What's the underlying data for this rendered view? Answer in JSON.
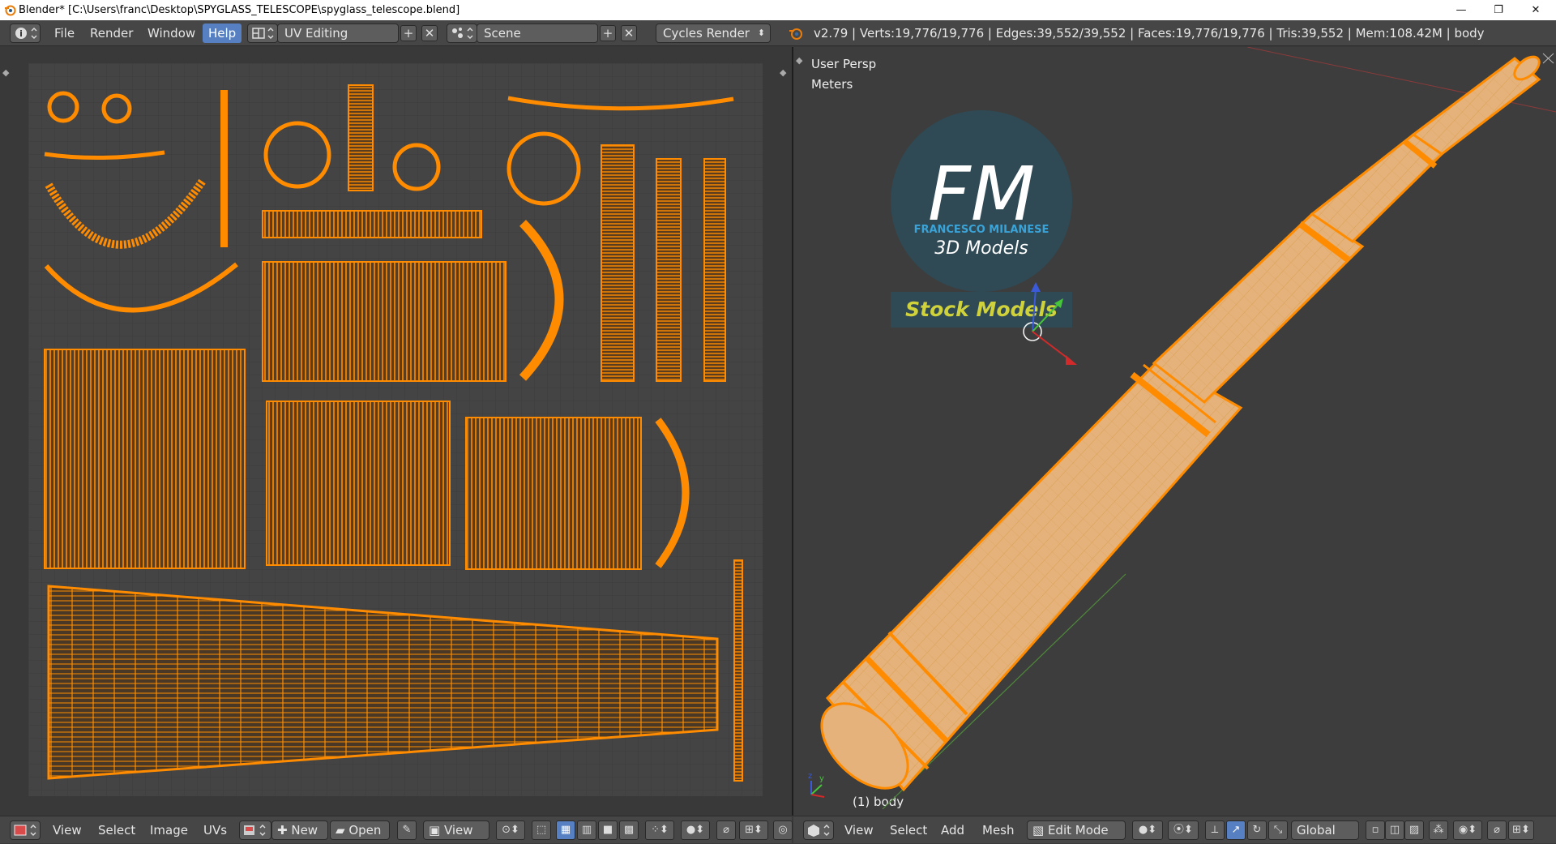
{
  "window": {
    "title": "Blender* [C:\\Users\\franc\\Desktop\\SPYGLASS_TELESCOPE\\spyglass_telescope.blend]",
    "minimize": "—",
    "maximize": "❐",
    "close": "✕"
  },
  "info_header": {
    "menus": [
      "File",
      "Render",
      "Window",
      "Help"
    ],
    "active_menu": "Help",
    "screen_layout": "UV Editing",
    "scene": "Scene",
    "render_engine": "Cycles Render",
    "stats": "v2.79 | Verts:19,776/19,776 | Edges:39,552/39,552 | Faces:19,776/19,776 | Tris:39,552 | Mem:108.42M | body"
  },
  "viewport": {
    "view_name": "User Persp",
    "units": "Meters",
    "object_label": "(1) body"
  },
  "logo": {
    "letters": "FM",
    "brand": "FRANCESCO MILANESE",
    "tagline": "3D Models",
    "banner": "Stock Models"
  },
  "uv_footer": {
    "menus": [
      "View",
      "Select",
      "Image",
      "UVs"
    ],
    "new_label": "New",
    "open_label": "Open",
    "view_label": "View"
  },
  "view3d_footer": {
    "menus": [
      "View",
      "Select",
      "Add",
      "Mesh"
    ],
    "mode": "Edit Mode",
    "orientation": "Global"
  },
  "colors": {
    "uv_orange": "#ff8c00",
    "accent_blue": "#5680c2",
    "mesh_surface": "#e2ae72"
  },
  "icons": [
    "blender-info-icon",
    "layout-icon",
    "scene-icon",
    "blender-render-icon",
    "image-editor-icon",
    "pin-icon",
    "cube-icon",
    "axis-gizmo-icon"
  ]
}
